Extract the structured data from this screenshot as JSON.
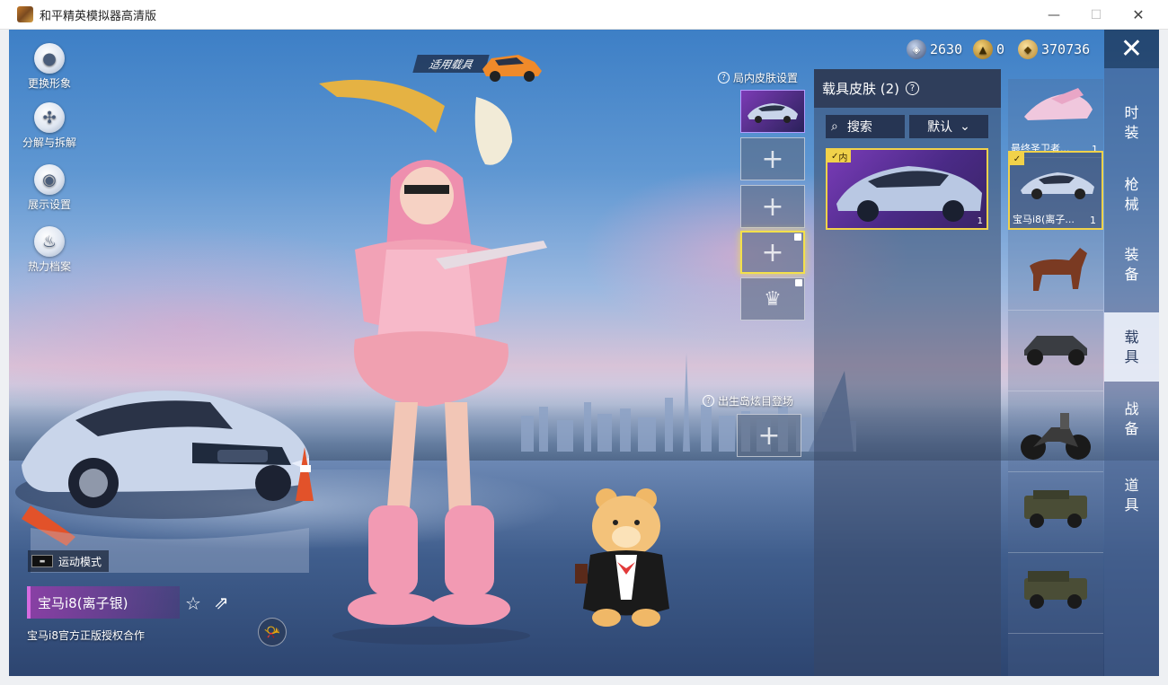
{
  "window": {
    "title": "和平精英模拟器高清版",
    "minimize": "—",
    "maximize": "☐",
    "close": "✕"
  },
  "quick_menu": [
    {
      "label": "更换形象",
      "icon": "avatar-icon"
    },
    {
      "label": "分解与拆解",
      "icon": "puzzle-icon"
    },
    {
      "label": "展示设置",
      "icon": "eye-icon"
    },
    {
      "label": "热力档案",
      "icon": "flame-icon"
    }
  ],
  "currency": [
    {
      "value": "2630",
      "icon": "coupon-icon"
    },
    {
      "value": "0",
      "icon": "medal-icon"
    },
    {
      "value": "370736",
      "icon": "gold-coin-icon"
    }
  ],
  "fit_vehicle_label": "适用载具",
  "slots": {
    "in_match_label": "局内皮肤设置",
    "island_label": "出生岛炫目登场"
  },
  "skin_panel": {
    "title": "载具皮肤 (2)",
    "search_label": "搜索",
    "sort_label": "默认",
    "card_tag": "内",
    "card_count": "1"
  },
  "vehicle_list": [
    {
      "name": "最终圣卫者...",
      "count": "1"
    },
    {
      "name": "宝马i8(离子...",
      "count": "1"
    },
    {
      "name": "",
      "count": ""
    },
    {
      "name": "",
      "count": ""
    },
    {
      "name": "",
      "count": ""
    },
    {
      "name": "",
      "count": ""
    },
    {
      "name": "",
      "count": ""
    }
  ],
  "categories": [
    {
      "line1": "时",
      "line2": "装"
    },
    {
      "line1": "枪",
      "line2": "械"
    },
    {
      "line1": "装",
      "line2": "备"
    },
    {
      "line1": "载",
      "line2": "具"
    },
    {
      "line1": "战",
      "line2": "备"
    },
    {
      "line1": "道",
      "line2": "具"
    }
  ],
  "active_category": 3,
  "bottom_info": {
    "sport_mode": "运动模式",
    "vehicle_name": "宝马i8(离子银)",
    "license": "宝马i8官方正版授权合作"
  },
  "colors": {
    "accent_gold": "#f1d24a",
    "accent_purple": "#d66be0",
    "panel_dark": "#2d3750"
  }
}
